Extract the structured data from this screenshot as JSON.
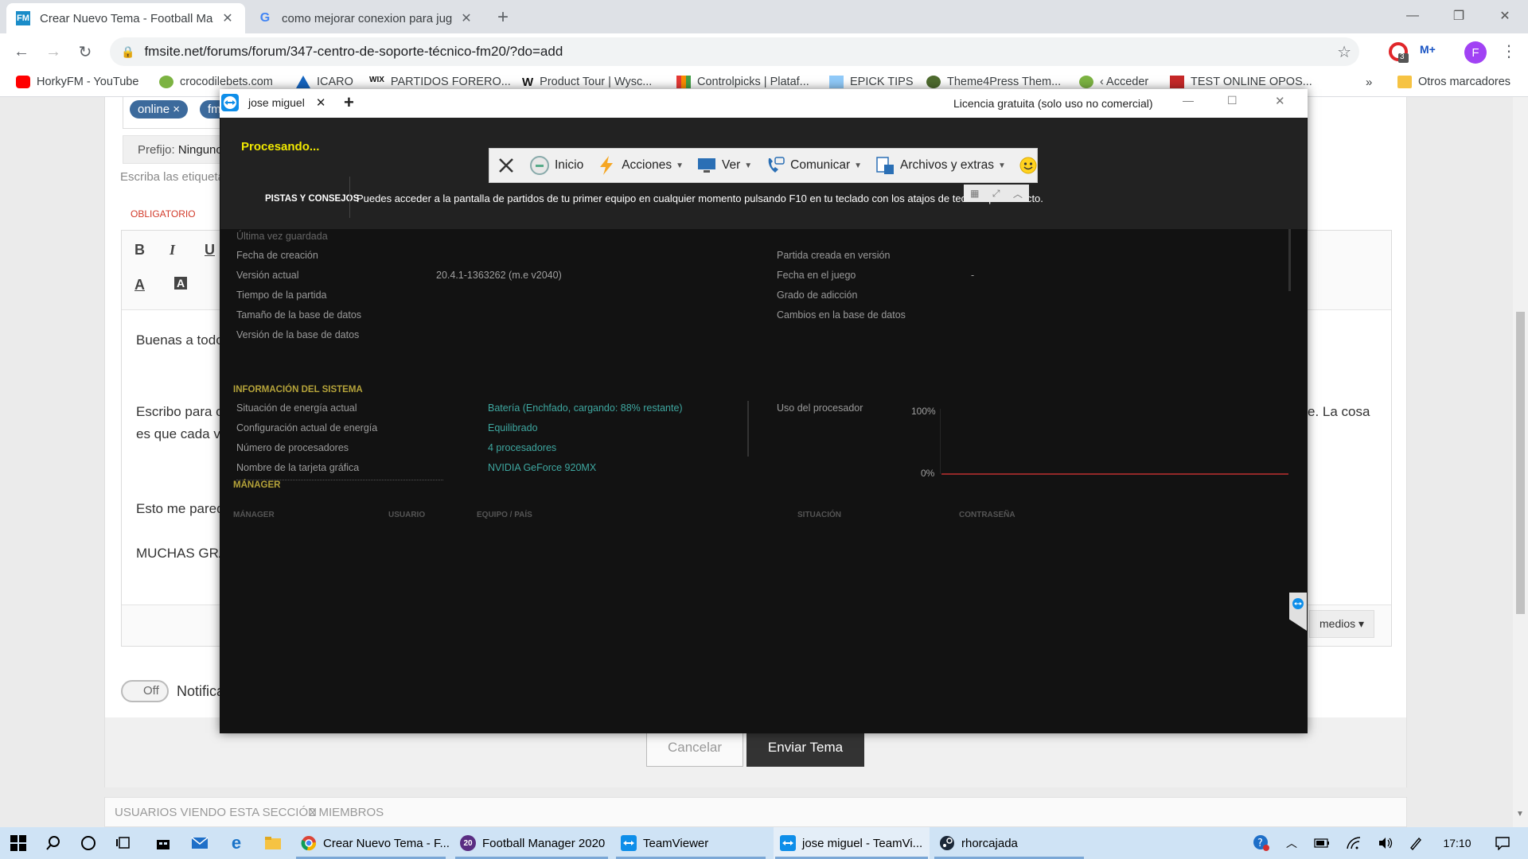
{
  "browser": {
    "tabs": [
      {
        "title": "Crear Nuevo Tema - Football Ma",
        "favicon": "FM"
      },
      {
        "title": "como mejorar conexion para jug",
        "favicon": "G"
      }
    ],
    "new_tab": "+",
    "url": "fmsite.net/forums/forum/347-centro-de-soporte-técnico-fm20/?do=add",
    "ext_badge": "3",
    "profile": "F",
    "bookmarks": [
      "HorkyFM - YouTube",
      "crocodilebets.com",
      "ICARO",
      "PARTIDOS FORERO...",
      "Product Tour | Wysc...",
      "Controlpicks | Plataf...",
      "EPICK TIPS",
      "Theme4Press Them...",
      "‹ Acceder",
      "TEST ONLINE OPOS..."
    ],
    "bookmarks_more": "»",
    "other_bookmarks": "Otros marcadores"
  },
  "forum": {
    "tags": [
      "online ×",
      "fm"
    ],
    "prefix_label": "Prefijo:",
    "prefix_value": "Ninguno",
    "tags_hint": "Escriba las etiqueta",
    "required": "OBLIGATORIO",
    "editor_lines": [
      "Buenas a todo",
      "Escribo para c",
      "es que cada v",
      "Esto me pared",
      "MUCHAS GRA"
    ],
    "right_text": "e. La cosa",
    "media_button": "medios ▾",
    "toggle_label": "Off",
    "notify_label": "Notifica",
    "cancel": "Cancelar",
    "submit": "Enviar Tema",
    "viewers": "USUARIOS VIENDO ESTA SECCIÓN",
    "viewers_count": "2 MIEMBROS"
  },
  "teamviewer": {
    "tab_label": "jose miguel",
    "license": "Licencia gratuita (solo uso no comercial)",
    "toolbar": {
      "inicio": "Inicio",
      "acciones": "Acciones",
      "ver": "Ver",
      "comunicar": "Comunicar",
      "archivos": "Archivos y extras"
    }
  },
  "fm": {
    "processing": "Procesando...",
    "tips_title": "PISTAS Y CONSEJOS",
    "tips_text": "Puedes acceder a la pantalla de partidos de tu primer equipo en cualquier momento pulsando F10 en tu teclado con los atajos de teclado por defecto.",
    "partial_row": "Última vez guardada",
    "left_rows": [
      {
        "label": "Fecha de creación",
        "value": ""
      },
      {
        "label": "Versión actual",
        "value": "20.4.1-1363262 (m.e v2040)"
      },
      {
        "label": "Tiempo de la partida",
        "value": ""
      },
      {
        "label": "Tamaño de la base de datos",
        "value": ""
      },
      {
        "label": "Versión de la base de datos",
        "value": ""
      }
    ],
    "right_rows": [
      {
        "label": "Partida creada en versión",
        "value": ""
      },
      {
        "label": "Fecha en el juego",
        "value": "-"
      },
      {
        "label": "Grado de adicción",
        "value": ""
      },
      {
        "label": "Cambios en la base de datos",
        "value": ""
      }
    ],
    "system_title": "INFORMACIÓN DEL SISTEMA",
    "system_rows": [
      {
        "label": "Situación de energía actual",
        "value": "Batería (Enchfado, cargando: 88% restante)"
      },
      {
        "label": "Configuración actual de energía",
        "value": "Equilibrado"
      },
      {
        "label": "Número de procesadores",
        "value": "4 procesadores"
      },
      {
        "label": "Nombre de la tarjeta gráfica",
        "value": "NVIDIA GeForce 920MX"
      }
    ],
    "cpu_label": "Uso del procesador",
    "cpu_top": "100%",
    "cpu_bottom": "0%",
    "cpu_usage_percent": 0,
    "manager_title": "MÁNAGER",
    "manager_cols": [
      "MÁNAGER",
      "USUARIO",
      "EQUIPO / PAÍS",
      "SITUACIÓN",
      "CONTRASEÑA"
    ]
  },
  "taskbar": {
    "apps": [
      {
        "label": "Crear Nuevo Tema - F..."
      },
      {
        "label": "Football Manager 2020"
      },
      {
        "label": "TeamViewer"
      },
      {
        "label": "jose miguel - TeamVi..."
      },
      {
        "label": "rhorcajada"
      }
    ],
    "fm_badge": "20",
    "clock": "17:10"
  },
  "colors": {
    "accent_yellow": "#f0e800",
    "fm_gold": "#b5a33a",
    "fm_teal": "#3ea7a0",
    "submit_bg": "#333333",
    "tag_blue": "#3c6a9c",
    "required_red": "#d23a2a"
  }
}
